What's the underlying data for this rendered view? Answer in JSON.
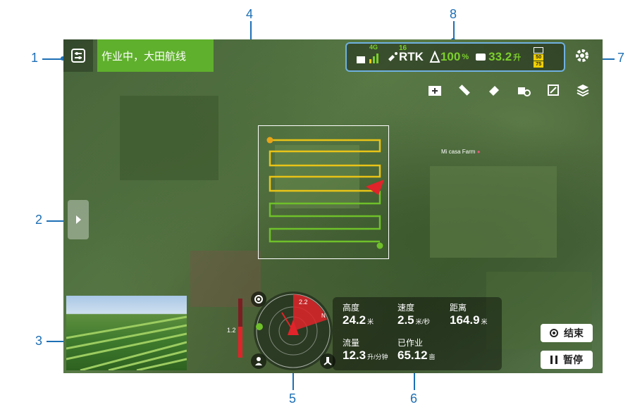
{
  "callouts": [
    "1",
    "2",
    "3",
    "4",
    "5",
    "6",
    "7",
    "8"
  ],
  "status_banner": "作业中，大田航线",
  "status_bar": {
    "signal_4g": "4G",
    "rtk_count": "16",
    "rtk_label": "RTK",
    "battery": "100",
    "battery_unit": "%",
    "tank": "33.2",
    "tank_unit": "升",
    "level_badges": [
      "",
      "50",
      "75"
    ]
  },
  "map_labels": {
    "farm": "Mi casa Farm"
  },
  "scale_value": "1.2",
  "compass": {
    "heading_value": "2.2",
    "north": "N"
  },
  "telemetry": {
    "height_label": "高度",
    "height_value": "24.2",
    "height_unit": "米",
    "speed_label": "速度",
    "speed_value": "2.5",
    "speed_unit": "米/秒",
    "distance_label": "距离",
    "distance_value": "164.9",
    "distance_unit": "米",
    "flow_label": "流量",
    "flow_value": "12.3",
    "flow_unit": "升/分钟",
    "done_label": "已作业",
    "done_value": "65.12",
    "done_unit": "亩"
  },
  "buttons": {
    "end": "结束",
    "pause": "暂停"
  },
  "icons": [
    "route-icon",
    "plus-folder-icon",
    "ruler-icon",
    "eraser-icon",
    "device-icon",
    "map-edit-icon",
    "layers-icon",
    "gear-icon"
  ],
  "colors": {
    "green_banner": "#5fb02c",
    "route_yellow": "#e8c317",
    "route_green": "#6fc02a",
    "accent_red": "#e0242a"
  }
}
